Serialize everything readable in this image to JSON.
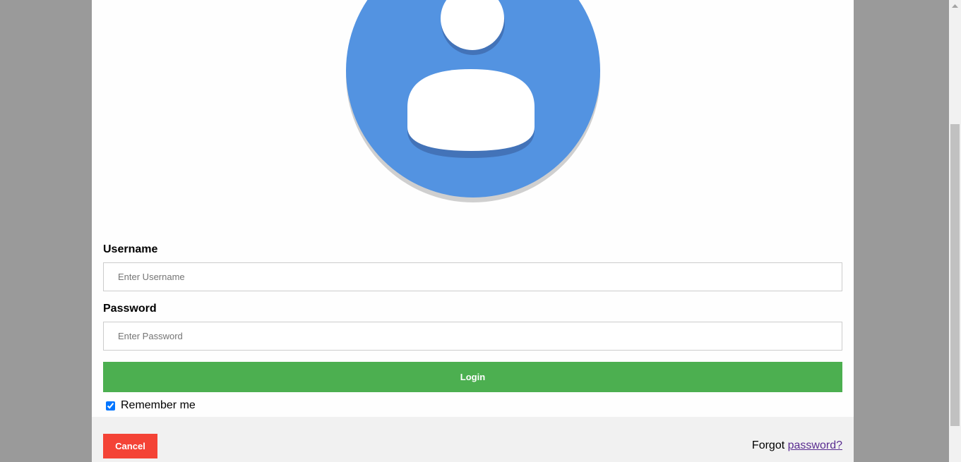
{
  "avatar": {
    "icon": "user-avatar-icon",
    "circle_color": "#5393e1",
    "figure_color": "#ffffff"
  },
  "form": {
    "username_label": "Username",
    "username_placeholder": "Enter Username",
    "username_value": "",
    "password_label": "Password",
    "password_placeholder": "Enter Password",
    "password_value": "",
    "login_label": "Login",
    "remember_label": "Remember me",
    "remember_checked": true
  },
  "footer": {
    "cancel_label": "Cancel",
    "forgot_prefix": "Forgot",
    "forgot_link": "password?"
  },
  "colors": {
    "login": "#4caf50",
    "cancel": "#f44336",
    "overlay": "#9a9a9a",
    "footer_bg": "#f1f1f1"
  }
}
